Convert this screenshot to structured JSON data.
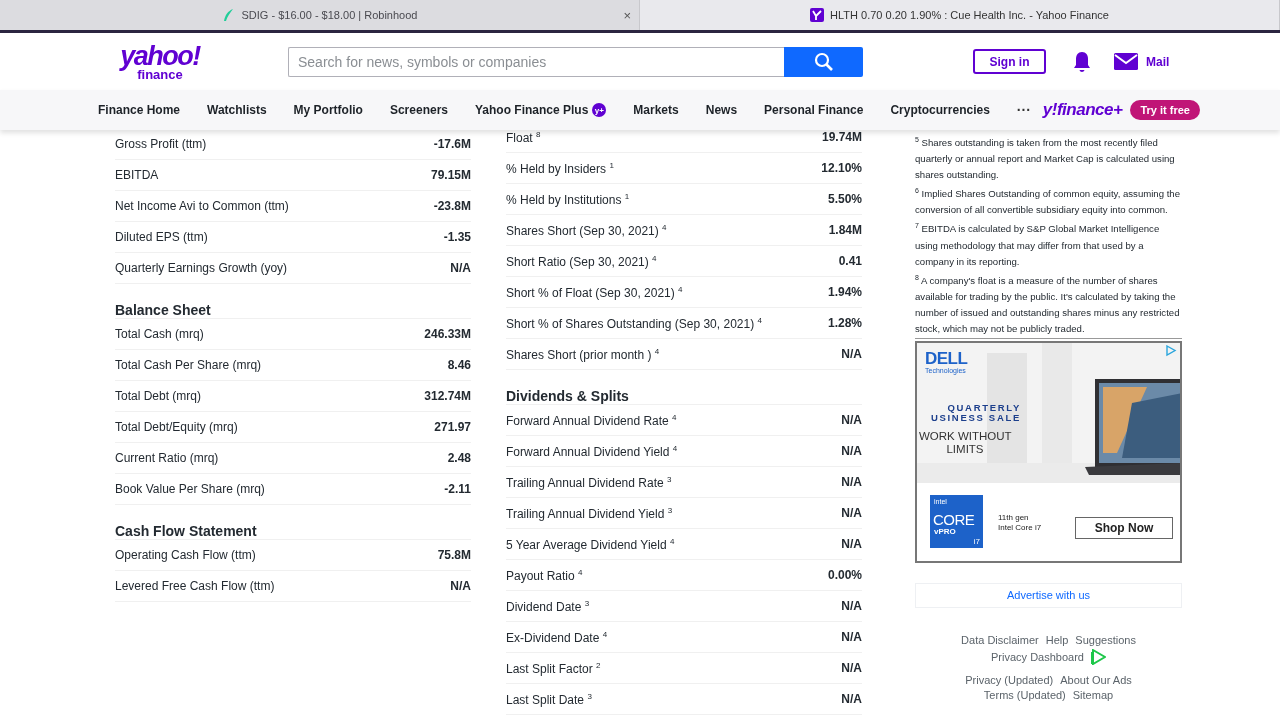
{
  "browser_tabs": [
    {
      "title": "SDIG - $16.00 - $18.00 | Robinhood",
      "selected": false,
      "close": "×"
    },
    {
      "title": "HLTH 0.70 0.20 1.90% : Cue Health Inc. - Yahoo Finance",
      "selected": true
    }
  ],
  "header": {
    "logo": {
      "brand": "yahoo!",
      "sub": "finance"
    },
    "search": {
      "placeholder": "Search for news, symbols or companies"
    },
    "sign_in": "Sign in",
    "mail": "Mail"
  },
  "nav": {
    "items": [
      {
        "label": "Finance Home"
      },
      {
        "label": "Watchlists"
      },
      {
        "label": "My Portfolio"
      },
      {
        "label": "Screeners"
      },
      {
        "label": "Yahoo Finance Plus",
        "badge": "y+"
      },
      {
        "label": "Markets"
      },
      {
        "label": "News"
      },
      {
        "label": "Personal Finance"
      },
      {
        "label": "Cryptocurrencies"
      }
    ],
    "more": "···",
    "plus_logo": "y!finance+",
    "try_button": "Try it free"
  },
  "columns": [
    {
      "sections": [
        {
          "rows": [
            {
              "label": "Gross Profit (ttm)",
              "value": "-17.6M"
            },
            {
              "label": "EBITDA",
              "value": "79.15M"
            },
            {
              "label": "Net Income Avi to Common (ttm)",
              "value": "-23.8M"
            },
            {
              "label": "Diluted EPS (ttm)",
              "value": "-1.35"
            },
            {
              "label": "Quarterly Earnings Growth (yoy)",
              "value": "N/A"
            }
          ]
        },
        {
          "heading": "Balance Sheet",
          "rows": [
            {
              "label": "Total Cash (mrq)",
              "value": "246.33M"
            },
            {
              "label": "Total Cash Per Share (mrq)",
              "value": "8.46"
            },
            {
              "label": "Total Debt (mrq)",
              "value": "312.74M"
            },
            {
              "label": "Total Debt/Equity (mrq)",
              "value": "271.97"
            },
            {
              "label": "Current Ratio (mrq)",
              "value": "2.48"
            },
            {
              "label": "Book Value Per Share (mrq)",
              "value": "-2.11"
            }
          ]
        },
        {
          "heading": "Cash Flow Statement",
          "rows": [
            {
              "label": "Operating Cash Flow (ttm)",
              "value": "75.8M"
            },
            {
              "label": "Levered Free Cash Flow (ttm)",
              "value": "N/A"
            }
          ]
        }
      ]
    },
    {
      "sections": [
        {
          "rows": [
            {
              "label": "Float $^{8}$",
              "value": "19.74M"
            },
            {
              "label": "% Held by Insiders $^{1}$",
              "value": "12.10%"
            },
            {
              "label": "% Held by Institutions $^{1}$",
              "value": "5.50%"
            },
            {
              "label": "Shares Short (Sep 30, 2021) $^{4}$",
              "value": "1.84M"
            },
            {
              "label": "Short Ratio (Sep 30, 2021) $^{4}$",
              "value": "0.41"
            },
            {
              "label": "Short % of Float (Sep 30, 2021) $^{4}$",
              "value": "1.94%"
            },
            {
              "label": "Short % of Shares Outstanding (Sep 30, 2021) $^{4}$",
              "value": "1.28%"
            },
            {
              "label": "Shares Short (prior month ) $^{4}$",
              "value": "N/A"
            }
          ]
        },
        {
          "heading": "Dividends & Splits",
          "rows": [
            {
              "label": "Forward Annual Dividend Rate $^{4}$",
              "value": "N/A"
            },
            {
              "label": "Forward Annual Dividend Yield $^{4}$",
              "value": "N/A"
            },
            {
              "label": "Trailing Annual Dividend Rate $^{3}$",
              "value": "N/A"
            },
            {
              "label": "Trailing Annual Dividend Yield $^{3}$",
              "value": "N/A"
            },
            {
              "label": "5 Year Average Dividend Yield $^{4}$",
              "value": "N/A"
            },
            {
              "label": "Payout Ratio $^{4}$",
              "value": "0.00%"
            },
            {
              "label": "Dividend Date $^{3}$",
              "value": "N/A"
            },
            {
              "label": "Ex-Dividend Date $^{4}$",
              "value": "N/A"
            },
            {
              "label": "Last Split Factor $^{2}$",
              "value": "N/A"
            },
            {
              "label": "Last Split Date $^{3}$",
              "value": "N/A"
            }
          ]
        }
      ]
    }
  ],
  "footnotes": [
    "$^{5}$ Shares outstanding is taken from the most recently filed quarterly or annual report and Market Cap is calculated using shares outstanding.",
    "$^{6}$ Implied Shares Outstanding of common equity, assuming the conversion of all convertible subsidiary equity into common.",
    "$^{7}$ EBITDA is calculated by S&P Global Market Intelligence using methodology that may differ from that used by a company in its reporting.",
    "$^{8}$ A company's float is a measure of the number of shares available for trading by the public. It's calculated by taking the number of issued and outstanding shares minus any restricted stock, which may not be publicly traded."
  ],
  "ad": {
    "brand": "DELL",
    "brand_sub": "Technologies",
    "headline": [
      "QUARTERLY",
      "USINESS SALE"
    ],
    "tagline": [
      "WORK WITHOUT",
      "LIMITS"
    ],
    "chip": {
      "maker": "intel",
      "line": "CORE",
      "sub": "vPRO",
      "model": "i7"
    },
    "chip_text": [
      "11th gen",
      "Intel Core i7"
    ],
    "button": "Shop Now"
  },
  "advertise": "Advertise with us",
  "footer": {
    "lines": [
      [
        "Data Disclaimer",
        "Help",
        "Suggestions"
      ],
      [
        "Privacy Dashboard"
      ],
      [
        "Privacy (Updated)",
        "About Our Ads"
      ],
      [
        "Terms (Updated)",
        "Sitemap"
      ]
    ]
  }
}
